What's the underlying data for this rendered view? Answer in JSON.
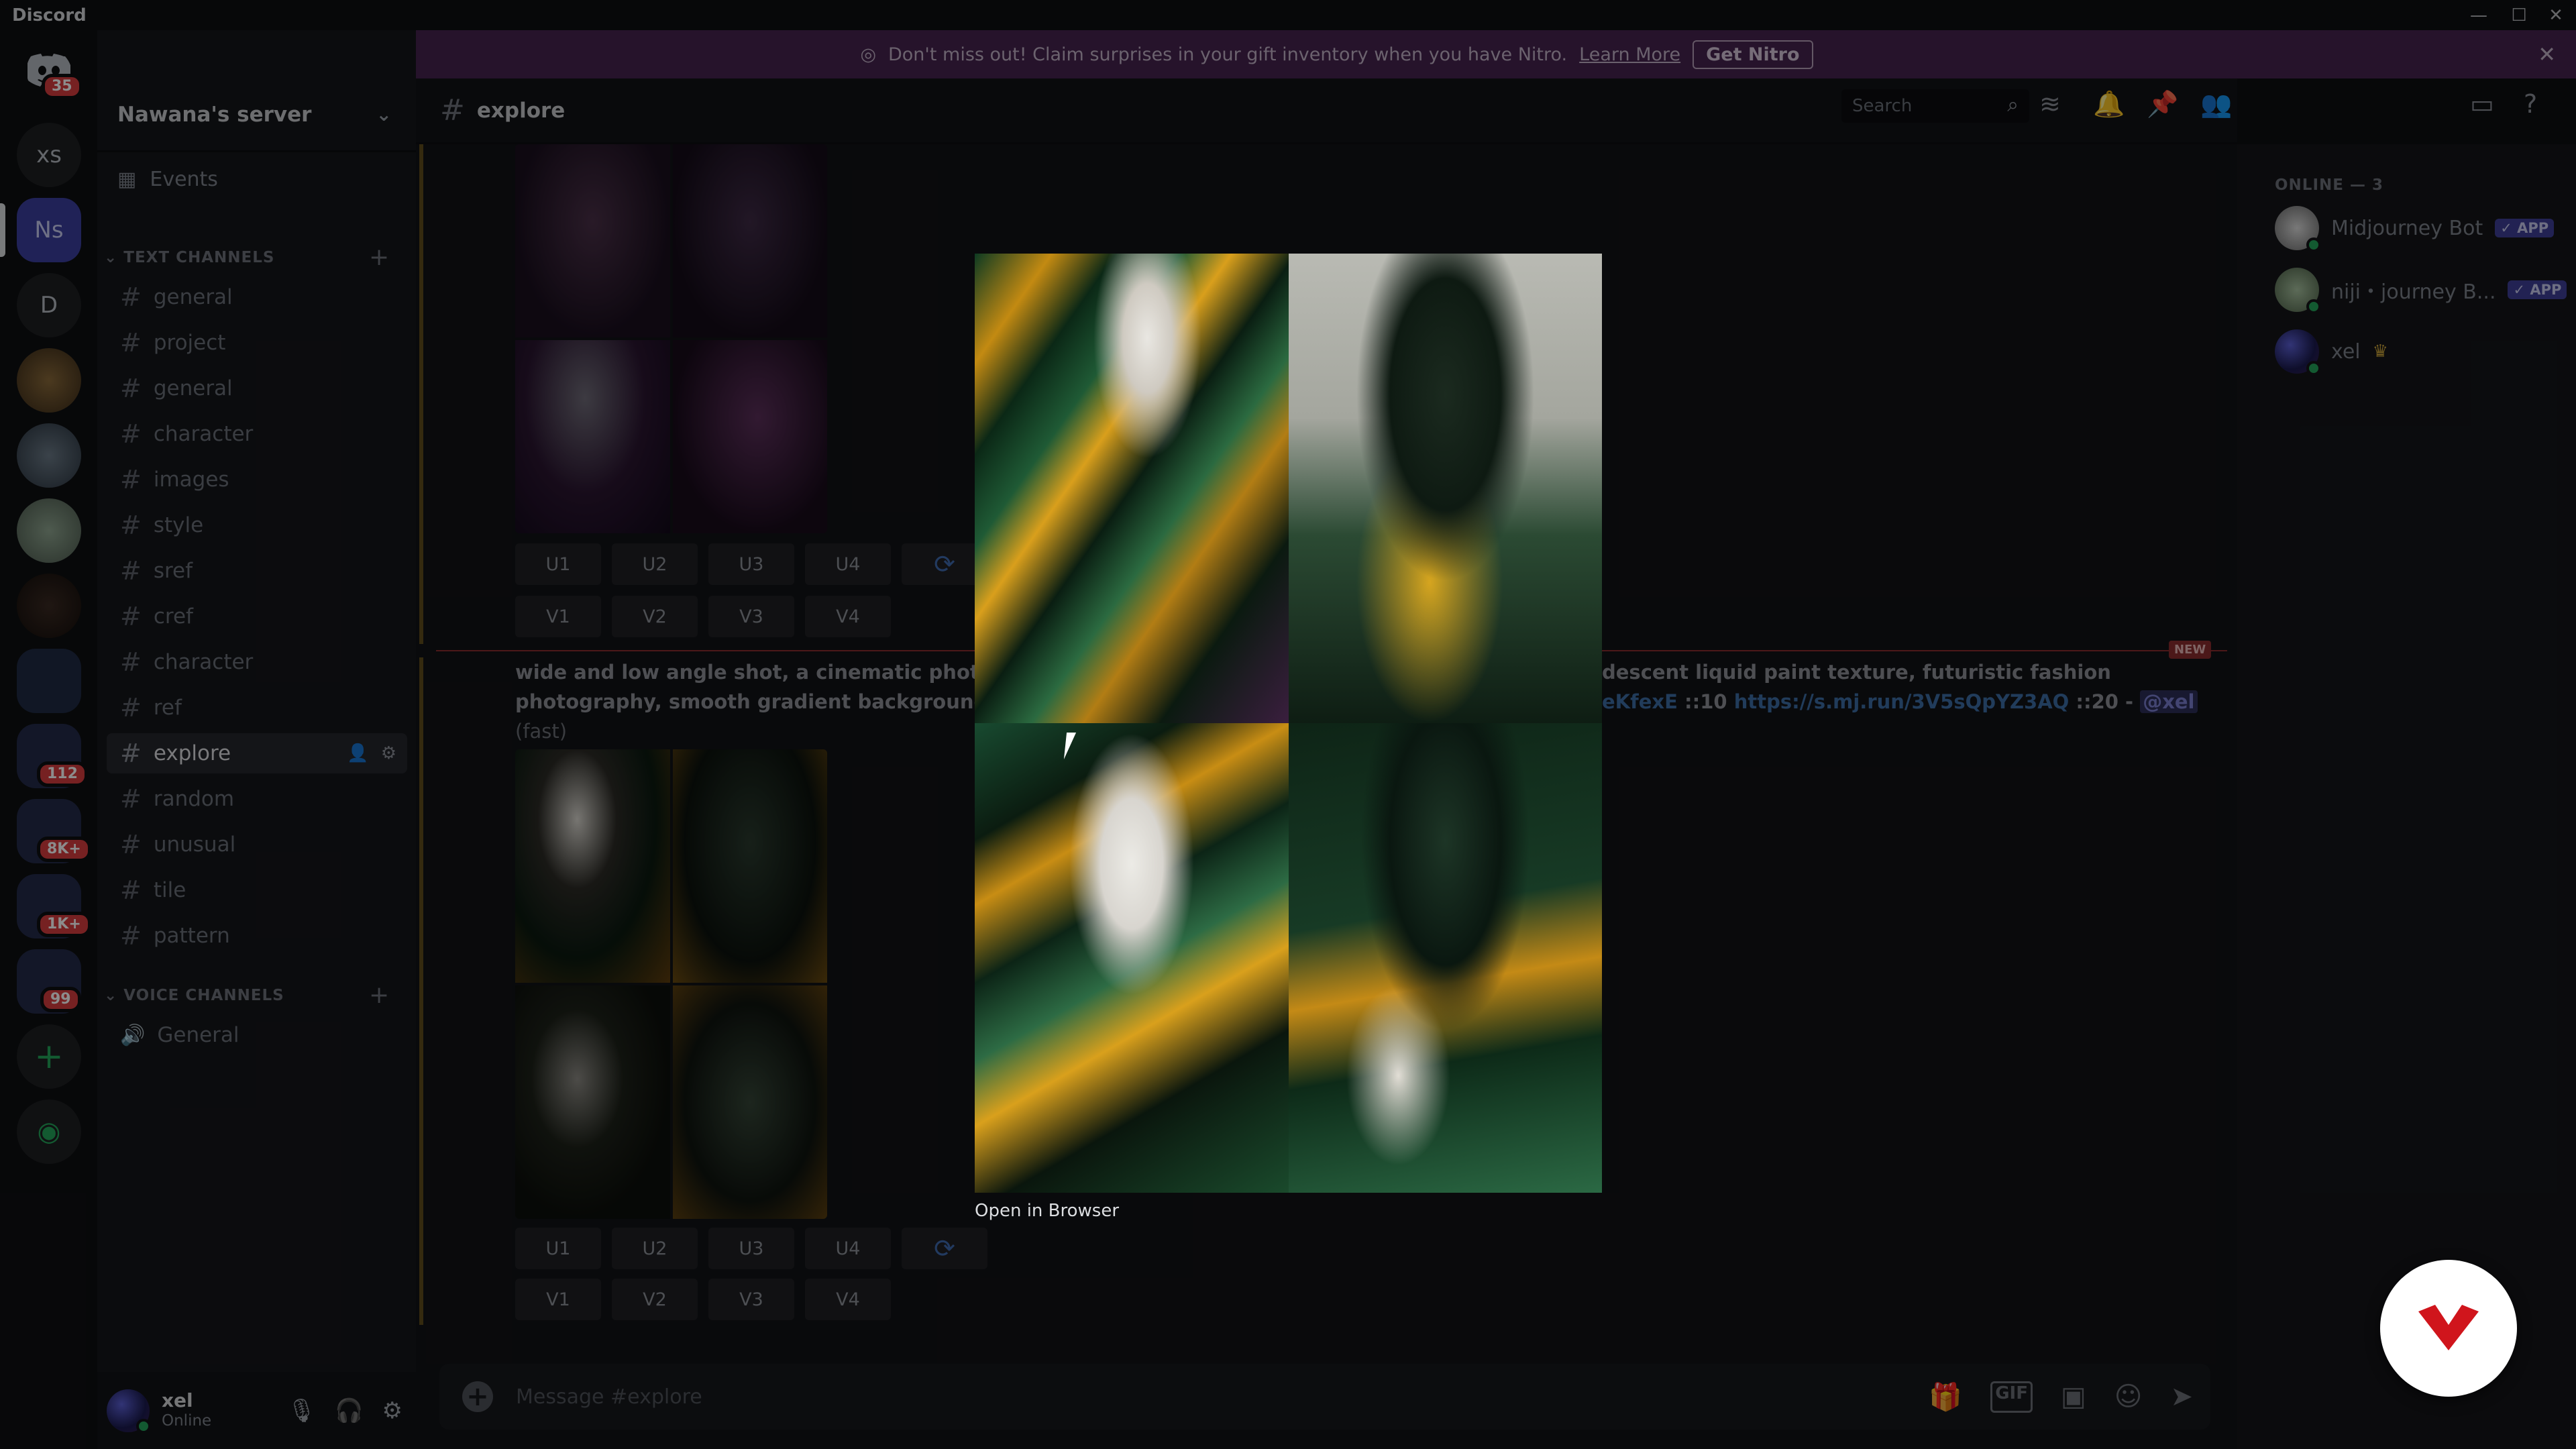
{
  "window": {
    "title": "Discord"
  },
  "nitro_banner": {
    "text": "Don't miss out! Claim surprises in your gift inventory when you have Nitro.",
    "link": "Learn More",
    "button": "Get Nitro"
  },
  "servers": {
    "home_badge": "35",
    "items": [
      "xs",
      "Ns",
      "D"
    ],
    "badges": [
      "112",
      "8K+",
      "1K+",
      "99"
    ]
  },
  "sidebar": {
    "server_name": "Nawana's server",
    "events": "Events",
    "text_category": "TEXT CHANNELS",
    "voice_category": "VOICE CHANNELS",
    "channels": [
      "general",
      "project",
      "general",
      "character",
      "images",
      "style",
      "sref",
      "cref",
      "character",
      "ref",
      "explore",
      "random",
      "unusual",
      "tile",
      "pattern"
    ],
    "voice_channels": [
      "General"
    ]
  },
  "user": {
    "name": "xel",
    "status": "Online"
  },
  "header": {
    "channel": "explore",
    "search_placeholder": "Search"
  },
  "members": {
    "heading": "ONLINE — 3",
    "list": [
      {
        "name": "Midjourney Bot",
        "tag": "✓ APP"
      },
      {
        "name": "niji・journey B...",
        "tag": "✓ APP"
      },
      {
        "name": "xel",
        "crown": "♛"
      }
    ]
  },
  "messages": {
    "upscale_buttons": [
      "U1",
      "U2",
      "U3",
      "U4"
    ],
    "variation_buttons": [
      "V1",
      "V2",
      "V3",
      "V4"
    ],
    "prompt_line1_a": "wide and low angle shot, a cinematic photo of a f",
    "prompt_line1_b": "descent liquid paint texture, futuristic fashion",
    "prompt_line2_a": "photography, smooth gradient background --ar 2",
    "prompt_line2_b1": "eKfexE",
    "prompt_line2_b2": " ::10 ",
    "prompt_line2_link": "https://s.mj.run/3V5sQpYZ3AQ",
    "prompt_line2_b3": " ::20 - ",
    "prompt_line2_mention": "@xel",
    "speed": "(fast)",
    "new_tag": "NEW"
  },
  "composer": {
    "placeholder": "Message #explore"
  },
  "lightbox": {
    "open_in_browser": "Open in Browser"
  }
}
